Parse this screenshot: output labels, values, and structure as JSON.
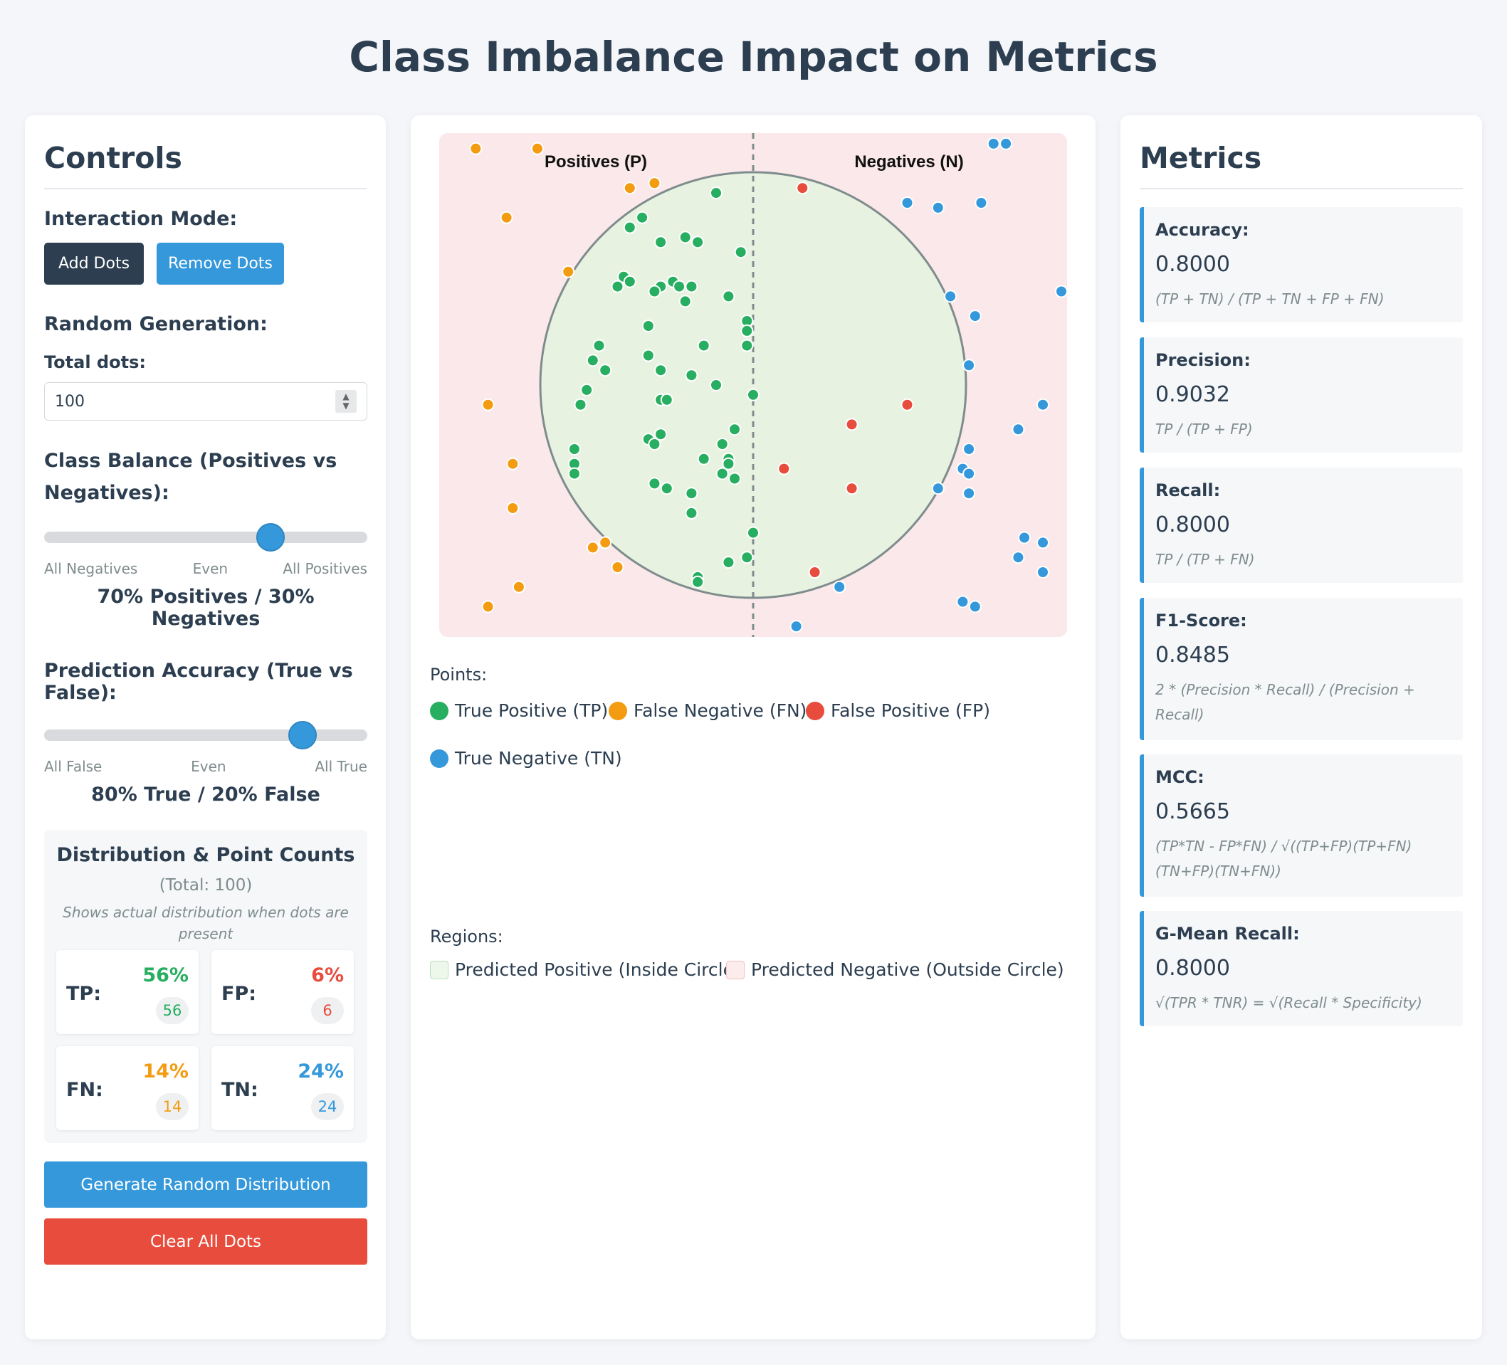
{
  "page_title": "Class Imbalance Impact on Metrics",
  "controls": {
    "title": "Controls",
    "interaction_mode_label": "Interaction Mode:",
    "add_dots_label": "Add Dots",
    "remove_dots_label": "Remove Dots",
    "random_generation_label": "Random Generation:",
    "total_dots_label": "Total dots:",
    "total_dots_value": "100",
    "class_balance_label": "Class Balance (Positives vs Negatives):",
    "class_balance": {
      "level": 0.7,
      "left": "All Negatives",
      "middle": "Even",
      "right": "All Positives",
      "value_text": "70% Positives / 30% Negatives"
    },
    "prediction_accuracy_label": "Prediction Accuracy (True vs False):",
    "prediction_accuracy": {
      "level": 0.8,
      "left": "All False",
      "middle": "Even",
      "right": "All True",
      "value_text": "80% True / 20% False"
    },
    "distribution": {
      "title": "Distribution & Point Counts",
      "total": "(Total: 100)",
      "note": "Shows actual distribution when dots are present",
      "cards": {
        "tp": {
          "label": "TP:",
          "pct": "56%",
          "count": "56"
        },
        "fp": {
          "label": "FP:",
          "pct": "6%",
          "count": "6"
        },
        "fn": {
          "label": "FN:",
          "pct": "14%",
          "count": "14"
        },
        "tn": {
          "label": "TN:",
          "pct": "24%",
          "count": "24"
        }
      }
    },
    "generate_label": "Generate Random Distribution",
    "clear_label": "Clear All Dots"
  },
  "viz": {
    "positives_label": "Positives (P)",
    "negatives_label": "Negatives (N)",
    "points_title": "Points:",
    "legend_points": {
      "tp": "True Positive (TP)",
      "fn": "False Negative (FN)",
      "fp": "False Positive (FP)",
      "tn": "True Negative (TN)"
    },
    "regions_title": "Regions:",
    "legend_regions": {
      "inside": "Predicted Positive (Inside Circle)",
      "outside": "Predicted Negative (Outside Circle)"
    },
    "colors": {
      "tp": "#27ae60",
      "fn": "#f39c12",
      "fp": "#e74c3c",
      "tn": "#3498db",
      "inside_fill": "#e8f2e1",
      "outside_fill": "#fae8ea"
    },
    "points": [
      {
        "c": "tp",
        "x": 0.44,
        "y": 0.11
      },
      {
        "c": "tp",
        "x": 0.32,
        "y": 0.16
      },
      {
        "c": "tp",
        "x": 0.3,
        "y": 0.18
      },
      {
        "c": "tp",
        "x": 0.35,
        "y": 0.21
      },
      {
        "c": "tp",
        "x": 0.39,
        "y": 0.2
      },
      {
        "c": "tp",
        "x": 0.41,
        "y": 0.21
      },
      {
        "c": "tp",
        "x": 0.48,
        "y": 0.23
      },
      {
        "c": "tp",
        "x": 0.29,
        "y": 0.28
      },
      {
        "c": "tp",
        "x": 0.3,
        "y": 0.29
      },
      {
        "c": "tp",
        "x": 0.28,
        "y": 0.3
      },
      {
        "c": "tp",
        "x": 0.35,
        "y": 0.3
      },
      {
        "c": "tp",
        "x": 0.37,
        "y": 0.29
      },
      {
        "c": "tp",
        "x": 0.38,
        "y": 0.3
      },
      {
        "c": "tp",
        "x": 0.4,
        "y": 0.3
      },
      {
        "c": "tp",
        "x": 0.34,
        "y": 0.31
      },
      {
        "c": "tp",
        "x": 0.39,
        "y": 0.33
      },
      {
        "c": "tp",
        "x": 0.46,
        "y": 0.32
      },
      {
        "c": "tp",
        "x": 0.49,
        "y": 0.37
      },
      {
        "c": "tp",
        "x": 0.49,
        "y": 0.39
      },
      {
        "c": "tp",
        "x": 0.49,
        "y": 0.42
      },
      {
        "c": "tp",
        "x": 0.33,
        "y": 0.38
      },
      {
        "c": "tp",
        "x": 0.25,
        "y": 0.42
      },
      {
        "c": "tp",
        "x": 0.33,
        "y": 0.44
      },
      {
        "c": "tp",
        "x": 0.42,
        "y": 0.42
      },
      {
        "c": "tp",
        "x": 0.35,
        "y": 0.47
      },
      {
        "c": "tp",
        "x": 0.4,
        "y": 0.48
      },
      {
        "c": "tp",
        "x": 0.26,
        "y": 0.47
      },
      {
        "c": "tp",
        "x": 0.44,
        "y": 0.5
      },
      {
        "c": "tp",
        "x": 0.23,
        "y": 0.51
      },
      {
        "c": "tp",
        "x": 0.5,
        "y": 0.52
      },
      {
        "c": "tp",
        "x": 0.35,
        "y": 0.53
      },
      {
        "c": "tp",
        "x": 0.36,
        "y": 0.53
      },
      {
        "c": "tp",
        "x": 0.22,
        "y": 0.54
      },
      {
        "c": "tp",
        "x": 0.47,
        "y": 0.59
      },
      {
        "c": "tp",
        "x": 0.35,
        "y": 0.6
      },
      {
        "c": "tp",
        "x": 0.33,
        "y": 0.61
      },
      {
        "c": "tp",
        "x": 0.34,
        "y": 0.62
      },
      {
        "c": "tp",
        "x": 0.45,
        "y": 0.62
      },
      {
        "c": "tp",
        "x": 0.21,
        "y": 0.63
      },
      {
        "c": "tp",
        "x": 0.42,
        "y": 0.65
      },
      {
        "c": "tp",
        "x": 0.46,
        "y": 0.65
      },
      {
        "c": "tp",
        "x": 0.21,
        "y": 0.66
      },
      {
        "c": "tp",
        "x": 0.46,
        "y": 0.66
      },
      {
        "c": "tp",
        "x": 0.21,
        "y": 0.68
      },
      {
        "c": "tp",
        "x": 0.45,
        "y": 0.68
      },
      {
        "c": "tp",
        "x": 0.47,
        "y": 0.69
      },
      {
        "c": "tp",
        "x": 0.34,
        "y": 0.7
      },
      {
        "c": "tp",
        "x": 0.36,
        "y": 0.71
      },
      {
        "c": "tp",
        "x": 0.4,
        "y": 0.72
      },
      {
        "c": "tp",
        "x": 0.5,
        "y": 0.8
      },
      {
        "c": "tp",
        "x": 0.49,
        "y": 0.85
      },
      {
        "c": "tp",
        "x": 0.46,
        "y": 0.86
      },
      {
        "c": "tp",
        "x": 0.41,
        "y": 0.89
      },
      {
        "c": "tp",
        "x": 0.41,
        "y": 0.9
      },
      {
        "c": "tp",
        "x": 0.24,
        "y": 0.45
      },
      {
        "c": "tp",
        "x": 0.4,
        "y": 0.76
      },
      {
        "c": "fn",
        "x": 0.05,
        "y": 0.02
      },
      {
        "c": "fn",
        "x": 0.15,
        "y": 0.02
      },
      {
        "c": "fn",
        "x": 0.3,
        "y": 0.1
      },
      {
        "c": "fn",
        "x": 0.34,
        "y": 0.09
      },
      {
        "c": "fn",
        "x": 0.1,
        "y": 0.16
      },
      {
        "c": "fn",
        "x": 0.2,
        "y": 0.27
      },
      {
        "c": "fn",
        "x": 0.07,
        "y": 0.54
      },
      {
        "c": "fn",
        "x": 0.11,
        "y": 0.66
      },
      {
        "c": "fn",
        "x": 0.11,
        "y": 0.75
      },
      {
        "c": "fn",
        "x": 0.24,
        "y": 0.83
      },
      {
        "c": "fn",
        "x": 0.26,
        "y": 0.82
      },
      {
        "c": "fn",
        "x": 0.28,
        "y": 0.87
      },
      {
        "c": "fn",
        "x": 0.12,
        "y": 0.91
      },
      {
        "c": "fn",
        "x": 0.07,
        "y": 0.95
      },
      {
        "c": "fp",
        "x": 0.58,
        "y": 0.1
      },
      {
        "c": "fp",
        "x": 0.75,
        "y": 0.54
      },
      {
        "c": "fp",
        "x": 0.66,
        "y": 0.58
      },
      {
        "c": "fp",
        "x": 0.55,
        "y": 0.67
      },
      {
        "c": "fp",
        "x": 0.66,
        "y": 0.71
      },
      {
        "c": "fp",
        "x": 0.6,
        "y": 0.88
      },
      {
        "c": "tn",
        "x": 0.89,
        "y": 0.01
      },
      {
        "c": "tn",
        "x": 0.91,
        "y": 0.01
      },
      {
        "c": "tn",
        "x": 0.75,
        "y": 0.13
      },
      {
        "c": "tn",
        "x": 0.8,
        "y": 0.14
      },
      {
        "c": "tn",
        "x": 0.87,
        "y": 0.13
      },
      {
        "c": "tn",
        "x": 0.82,
        "y": 0.32
      },
      {
        "c": "tn",
        "x": 0.86,
        "y": 0.36
      },
      {
        "c": "tn",
        "x": 1.0,
        "y": 0.31
      },
      {
        "c": "tn",
        "x": 0.85,
        "y": 0.46
      },
      {
        "c": "tn",
        "x": 0.97,
        "y": 0.54
      },
      {
        "c": "tn",
        "x": 0.93,
        "y": 0.59
      },
      {
        "c": "tn",
        "x": 0.85,
        "y": 0.63
      },
      {
        "c": "tn",
        "x": 0.84,
        "y": 0.67
      },
      {
        "c": "tn",
        "x": 0.85,
        "y": 0.68
      },
      {
        "c": "tn",
        "x": 0.8,
        "y": 0.71
      },
      {
        "c": "tn",
        "x": 0.85,
        "y": 0.72
      },
      {
        "c": "tn",
        "x": 0.94,
        "y": 0.81
      },
      {
        "c": "tn",
        "x": 0.97,
        "y": 0.82
      },
      {
        "c": "tn",
        "x": 0.93,
        "y": 0.85
      },
      {
        "c": "tn",
        "x": 0.97,
        "y": 0.88
      },
      {
        "c": "tn",
        "x": 0.64,
        "y": 0.91
      },
      {
        "c": "tn",
        "x": 0.84,
        "y": 0.94
      },
      {
        "c": "tn",
        "x": 0.86,
        "y": 0.95
      },
      {
        "c": "tn",
        "x": 0.57,
        "y": 0.99
      }
    ]
  },
  "metrics": {
    "title": "Metrics",
    "items": [
      {
        "name": "Accuracy:",
        "value": "0.8000",
        "formula": "(TP + TN) / (TP + TN + FP + FN)"
      },
      {
        "name": "Precision:",
        "value": "0.9032",
        "formula": "TP / (TP + FP)"
      },
      {
        "name": "Recall:",
        "value": "0.8000",
        "formula": "TP / (TP + FN)"
      },
      {
        "name": "F1-Score:",
        "value": "0.8485",
        "formula": "2 * (Precision * Recall) / (Precision + Recall)"
      },
      {
        "name": "MCC:",
        "value": "0.5665",
        "formula": "(TP*TN - FP*FN) / √((TP+FP)(TP+FN)(TN+FP)(TN+FN))"
      },
      {
        "name": "G-Mean Recall:",
        "value": "0.8000",
        "formula": "√(TPR * TNR) = √(Recall * Specificity)"
      }
    ]
  }
}
